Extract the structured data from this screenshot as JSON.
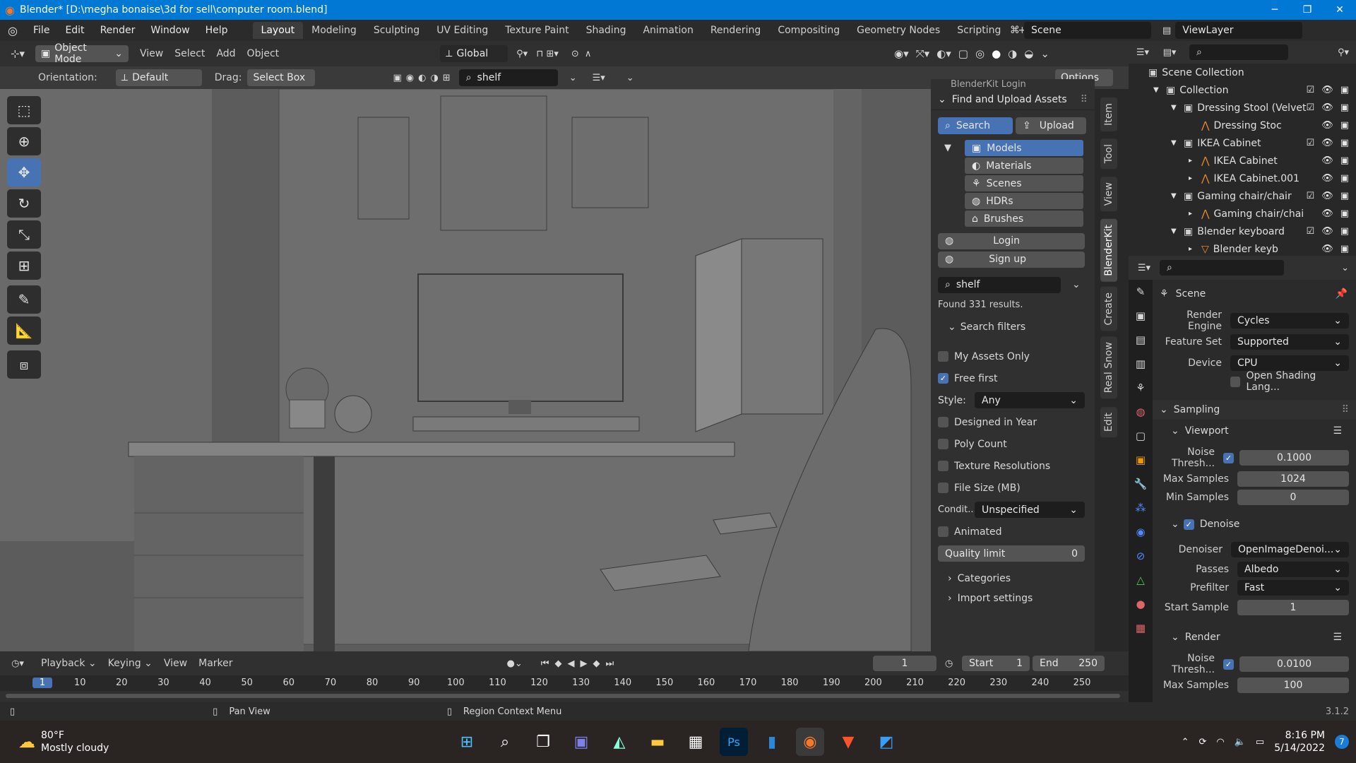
{
  "window": {
    "title": "Blender* [D:\\megha bonaise\\3d for sell\\computer room.blend]",
    "minimize": "─",
    "maximize": "❐",
    "close": "✕"
  },
  "menu": {
    "items": [
      "File",
      "Edit",
      "Render",
      "Window",
      "Help"
    ],
    "workspaces": [
      "Layout",
      "Modeling",
      "Sculpting",
      "UV Editing",
      "Texture Paint",
      "Shading",
      "Animation",
      "Rendering",
      "Compositing",
      "Geometry Nodes",
      "Scripting"
    ],
    "active_workspace": "Layout",
    "add_tab": "+",
    "scene": "Scene",
    "view_layer": "ViewLayer"
  },
  "header": {
    "mode": "Object Mode",
    "menus": [
      "View",
      "Select",
      "Add",
      "Object"
    ],
    "transform": "Global",
    "options": "Options"
  },
  "tool_settings": {
    "orientation_label": "Orientation:",
    "orientation_value": "Default",
    "drag_label": "Drag:",
    "drag_value": "Select Box",
    "search_value": "shelf"
  },
  "blenderkit": {
    "collapsed_header": "BlenderKit Login",
    "panel_title": "Find and Upload Assets",
    "search_btn": "Search",
    "upload_btn": "Upload",
    "asset_types": [
      "Models",
      "Materials",
      "Scenes",
      "HDRs",
      "Brushes"
    ],
    "active_type": "Models",
    "login": "Login",
    "signup": "Sign up",
    "search_text": "shelf",
    "results": "Found 331 results.",
    "search_filters": "Search filters",
    "my_assets": "My Assets Only",
    "free_first": "Free first",
    "style_label": "Style:",
    "style_value": "Any",
    "designed_year": "Designed in Year",
    "poly_count": "Poly Count",
    "tex_res": "Texture Resolutions",
    "file_size": "File Size (MB)",
    "condition_label": "Condit...",
    "condition_value": "Unspecified",
    "animated": "Animated",
    "quality_label": "Quality limit",
    "quality_value": "0",
    "categories": "Categories",
    "import_settings": "Import settings"
  },
  "sidebar_tabs": [
    "Item",
    "Tool",
    "View",
    "BlenderKit",
    "Create",
    "Real Snow",
    "Edit"
  ],
  "outliner": {
    "rows": [
      {
        "indent": 0,
        "label": "Scene Collection",
        "icon": "▣",
        "arrow": ""
      },
      {
        "indent": 1,
        "label": "Collection",
        "icon": "▣",
        "arrow": "▼"
      },
      {
        "indent": 2,
        "label": "Dressing Stool (Velvet",
        "icon": "▣",
        "arrow": "▼"
      },
      {
        "indent": 3,
        "label": "Dressing Stoc",
        "icon": "⋀",
        "arrow": ""
      },
      {
        "indent": 2,
        "label": "IKEA Cabinet",
        "icon": "▣",
        "arrow": "▼"
      },
      {
        "indent": 3,
        "label": "IKEA Cabinet",
        "icon": "⋀",
        "arrow": "▸"
      },
      {
        "indent": 3,
        "label": "IKEA Cabinet.001",
        "icon": "⋀",
        "arrow": "▸"
      },
      {
        "indent": 2,
        "label": "Gaming chair/chair",
        "icon": "▣",
        "arrow": "▼"
      },
      {
        "indent": 3,
        "label": "Gaming chair/chai",
        "icon": "⋀",
        "arrow": "▸"
      },
      {
        "indent": 2,
        "label": "Blender keyboard",
        "icon": "▣",
        "arrow": "▼"
      },
      {
        "indent": 3,
        "label": "Blender keyb",
        "icon": "▽",
        "arrow": "▸"
      }
    ]
  },
  "properties": {
    "scene_title": "Scene",
    "render_engine_label": "Render Engine",
    "render_engine": "Cycles",
    "feature_set_label": "Feature Set",
    "feature_set": "Supported",
    "device_label": "Device",
    "device": "CPU",
    "osl": "Open Shading Lang...",
    "sampling": "Sampling",
    "viewport": "Viewport",
    "noise_label": "Noise Thresh...",
    "noise_vp": "0.1000",
    "max_samples_label": "Max Samples",
    "max_samples_vp": "1024",
    "min_samples_label": "Min Samples",
    "min_samples_vp": "0",
    "denoise": "Denoise",
    "denoiser_label": "Denoiser",
    "denoiser": "OpenImageDenoi...",
    "passes_label": "Passes",
    "passes": "Albedo",
    "prefilter_label": "Prefilter",
    "prefilter": "Fast",
    "start_sample_label": "Start Sample",
    "start_sample": "1",
    "render": "Render",
    "noise_render": "0.0100",
    "max_samples_render": "100"
  },
  "timeline": {
    "menus": [
      "Playback",
      "Keying",
      "View",
      "Marker"
    ],
    "current_frame": "1",
    "start_label": "Start",
    "start": "1",
    "end_label": "End",
    "end": "250",
    "ticks": [
      "1",
      "10",
      "20",
      "30",
      "40",
      "50",
      "60",
      "70",
      "80",
      "90",
      "100",
      "110",
      "120",
      "130",
      "140",
      "150",
      "160",
      "170",
      "180",
      "190",
      "200",
      "210",
      "220",
      "230",
      "240",
      "250"
    ]
  },
  "status": {
    "pan": "Pan View",
    "context": "Region Context Menu",
    "version": "3.1.2"
  },
  "taskbar": {
    "temp": "80°F",
    "weather": "Mostly cloudy",
    "time": "8:16 PM",
    "date": "5/14/2022",
    "notif": "7"
  }
}
